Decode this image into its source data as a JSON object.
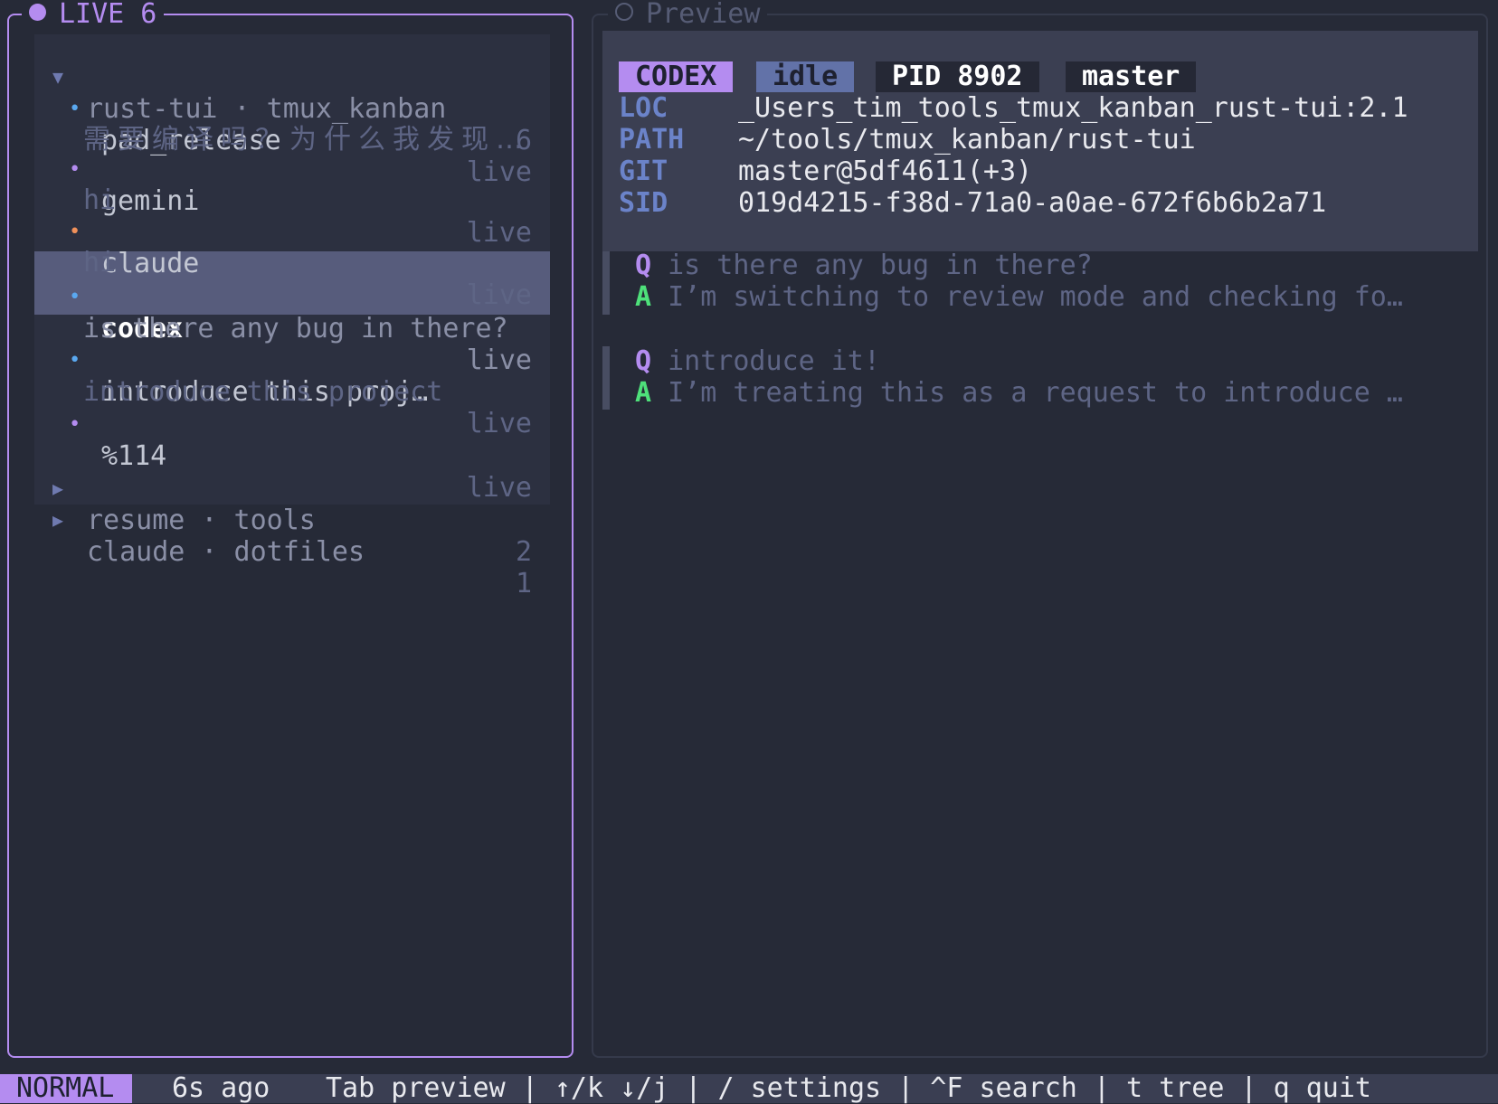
{
  "left": {
    "title": "LIVE 6",
    "groups": [
      {
        "label": "rust-tui · tmux_kanban",
        "count": "6",
        "expanded": true,
        "sessions": [
          {
            "name": "pad_release",
            "status": "live",
            "preview": "需要编译吗？为什么我发现…",
            "dot_color": "#5aa8f0"
          },
          {
            "name": "gemini",
            "status": "live",
            "preview": "hi",
            "dot_color": "#b48cf0"
          },
          {
            "name": "claude",
            "status": "live",
            "preview": "hi",
            "dot_color": "#f0905a"
          },
          {
            "name": "codex",
            "status": "live",
            "preview": "is there any bug in there?",
            "dot_color": "#5aa8f0",
            "selected": true
          },
          {
            "name": "introduce this proj…",
            "status": "live",
            "preview": "introduce this project",
            "dot_color": "#5aa8f0"
          },
          {
            "name": "%114",
            "status": "live",
            "preview": "",
            "dot_color": "#b48cf0"
          }
        ]
      },
      {
        "label": "resume · tools",
        "count": "2",
        "expanded": false
      },
      {
        "label": "claude · dotfiles",
        "count": "1",
        "expanded": false
      }
    ]
  },
  "preview": {
    "title": "Preview",
    "badges": {
      "agent": "CODEX",
      "state": "idle",
      "pid": "PID 8902",
      "branch": "master"
    },
    "info": [
      {
        "key": "LOC",
        "value": "_Users_tim_tools_tmux_kanban_rust-tui:2.1"
      },
      {
        "key": "PATH",
        "value": "~/tools/tmux_kanban/rust-tui"
      },
      {
        "key": "GIT",
        "value": "master@5df4611(+3)"
      },
      {
        "key": "SID",
        "value": "019d4215-f38d-71a0-a0ae-672f6b6b2a71"
      }
    ],
    "conversation": [
      {
        "q_marker": "Q",
        "q": "is there any bug in there?",
        "a_marker": "A",
        "a": "I’m switching to review mode and checking fo…"
      },
      {
        "q_marker": "Q",
        "q": "introduce it!",
        "a_marker": "A",
        "a": "I’m treating this as a request to introduce …"
      }
    ]
  },
  "status_bar": {
    "mode": "NORMAL",
    "updated": "6s ago",
    "hints": "Tab preview | ↑/k ↓/j | / settings | ^F search | t tree | q quit"
  },
  "colors": {
    "accent": "#b48cf0",
    "background": "#262a37",
    "answer_marker": "#4ee07a"
  }
}
